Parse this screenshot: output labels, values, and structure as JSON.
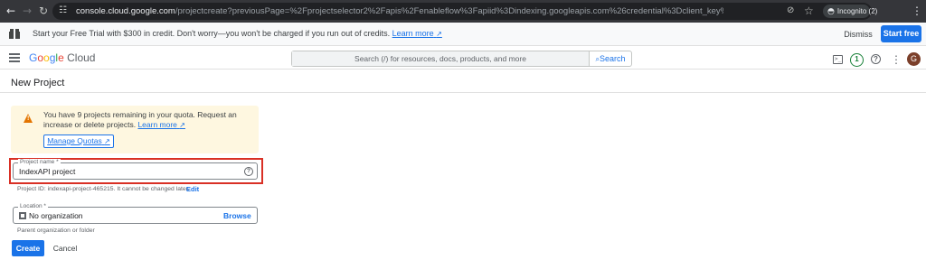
{
  "browser": {
    "url_host": "console.cloud.google.com",
    "url_rest": "/projectcreate?previousPage=%2Fprojectselector2%2Fapis%2Fenableflow%3Fapiid%3Dindexing.googleapis.com%26credential%3Dclient_key%26pli%3D1%26supportedpurview%3Dproject%26inv%3D1%26invt%3DAb2I...",
    "incognito_label": "Incognito (2)"
  },
  "banner": {
    "text": "Start your Free Trial with $300 in credit. Don't worry—you won't be charged if you run out of credits.",
    "learn_more": "Learn more",
    "dismiss": "Dismiss",
    "start_free": "Start free"
  },
  "header": {
    "logo_google": [
      "G",
      "o",
      "o",
      "g",
      "l",
      "e"
    ],
    "logo_cloud": "Cloud",
    "search_placeholder": "Search (/) for resources, docs, products, and more",
    "search_button": "Search",
    "notification_count": "1",
    "avatar_initial": "G"
  },
  "page": {
    "title": "New Project",
    "quota_text": "You have 9 projects remaining in your quota. Request an increase or delete projects.",
    "quota_learn_more": "Learn more",
    "manage_quotas": "Manage Quotas",
    "project_name_label": "Project name *",
    "project_name_value": "IndexAPI project",
    "project_id_text": "Project ID: indexapi-project-465215. It cannot be changed later.",
    "edit": "Edit",
    "location_label": "Location *",
    "location_value": "No organization",
    "browse": "Browse",
    "location_helper": "Parent organization or folder",
    "create": "Create",
    "cancel": "Cancel"
  },
  "icons": {
    "back": "arrow-left-icon",
    "forward": "arrow-right-icon",
    "reload": "reload-icon",
    "site_info": "tune-icon",
    "eye_off": "eye-off-icon",
    "star": "star-icon",
    "incognito": "incognito-icon",
    "menu": "more-vert-icon",
    "gift": "gift-icon",
    "warning": "warning-icon",
    "help": "help-icon",
    "terminal": "terminal-icon"
  },
  "colors": {
    "accent": "#1a73e8",
    "chrome_bar": "#35363a",
    "warning_bg": "#fef7e0",
    "warning_icon": "#e37400",
    "highlight": "#d93025",
    "badge_green": "#188038"
  }
}
